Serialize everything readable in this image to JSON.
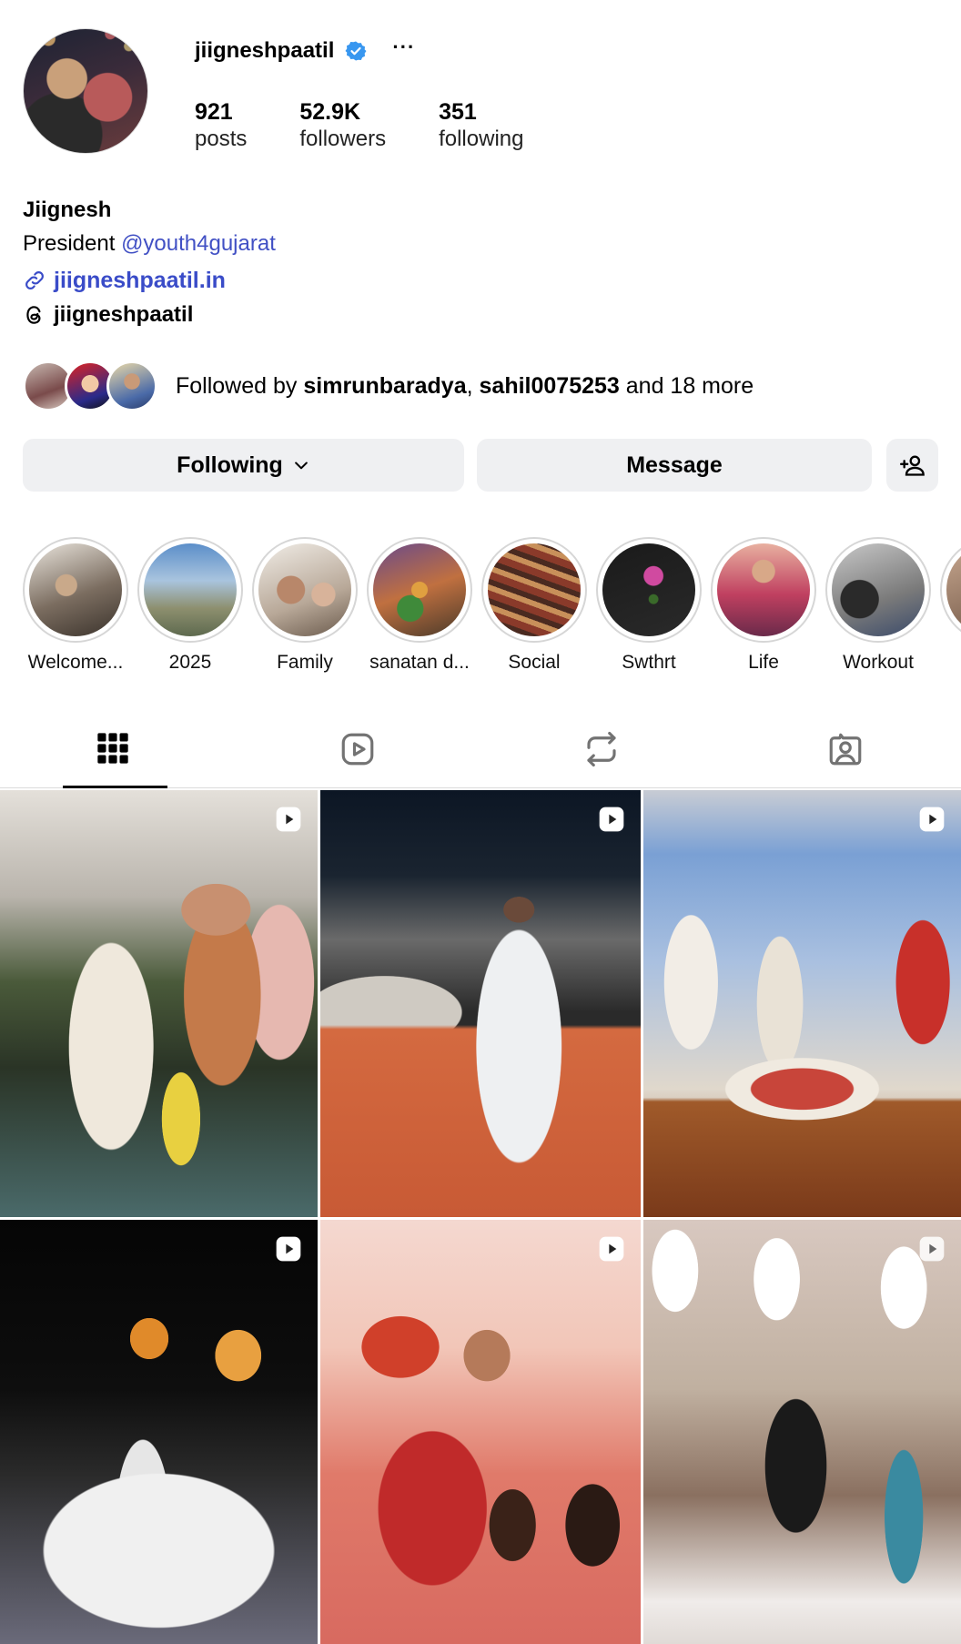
{
  "profile": {
    "username": "jiigneshpaatil",
    "more_label": "···",
    "stats": [
      {
        "num": "921",
        "label": "posts"
      },
      {
        "num": "52.9K",
        "label": "followers"
      },
      {
        "num": "351",
        "label": "following"
      }
    ],
    "name": "Jiignesh",
    "bio_prefix": "President ",
    "bio_mention": "@youth4gujarat",
    "link": "jiigneshpaatil.in",
    "threads": "jiigneshpaatil",
    "followed_by": {
      "prefix": "Followed by ",
      "user1": "simrunbaradya",
      "sep": ", ",
      "user2": "sahil0075253",
      "suffix": " and 18 more"
    }
  },
  "buttons": {
    "following": "Following",
    "message": "Message"
  },
  "highlights": [
    {
      "label": "Welcome..."
    },
    {
      "label": "2025"
    },
    {
      "label": "Family"
    },
    {
      "label": "sanatan d..."
    },
    {
      "label": "Social"
    },
    {
      "label": "Swthrt"
    },
    {
      "label": "Life"
    },
    {
      "label": "Workout"
    },
    {
      "label": ""
    }
  ],
  "tabs": [
    "posts-grid-icon",
    "reels-icon",
    "reposts-icon",
    "tagged-icon"
  ],
  "posts": [
    {
      "type": "reel"
    },
    {
      "type": "reel"
    },
    {
      "type": "reel"
    },
    {
      "type": "reel"
    },
    {
      "type": "reel"
    },
    {
      "type": "reel"
    }
  ],
  "colors": {
    "link": "#3a4cc8",
    "verified": "#3897f0",
    "button_bg": "#eff0f2"
  }
}
